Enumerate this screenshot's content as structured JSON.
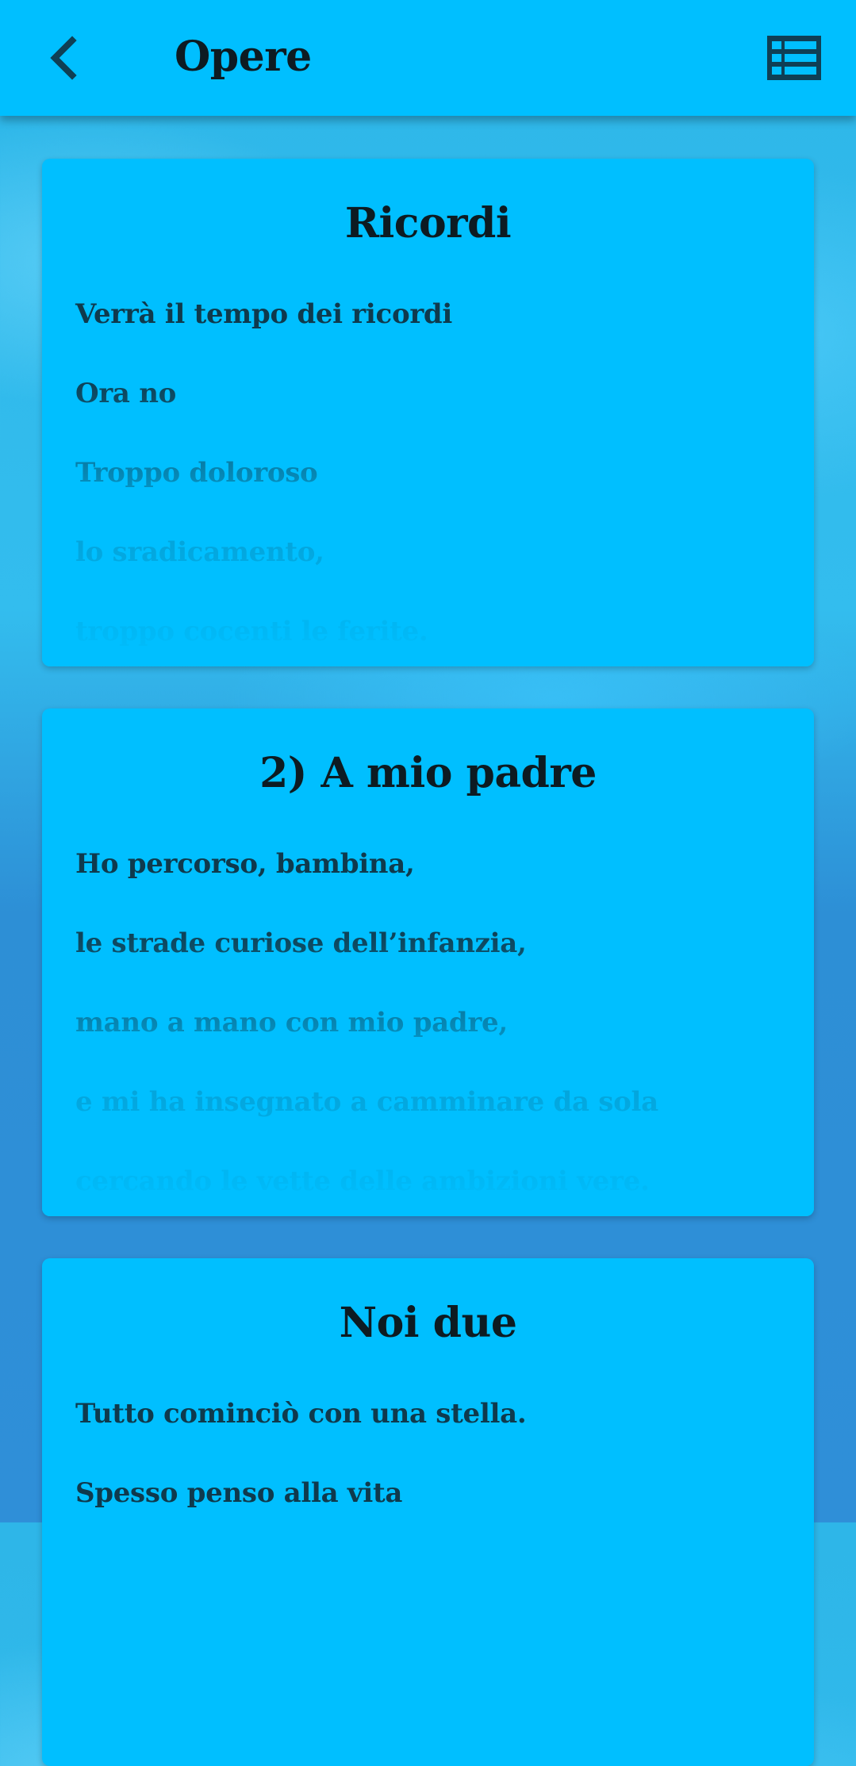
{
  "header": {
    "title": "Opere",
    "back_icon": "chevron-left-icon",
    "menu_icon": "list-view-icon"
  },
  "colors": {
    "accent": "#00bfff",
    "text": "#0d1b22"
  },
  "cards": [
    {
      "title": "Ricordi",
      "lines": [
        "Verrà il tempo dei ricordi",
        "Ora no",
        "Troppo doloroso",
        "lo sradicamento,",
        "troppo cocenti le ferite."
      ]
    },
    {
      "title": "2) A mio padre",
      "lines": [
        "Ho percorso, bambina,",
        "le strade curiose dell’infanzia,",
        "mano a mano con mio padre,",
        "e mi ha insegnato a camminare da sola",
        "cercando le vette delle ambizioni vere."
      ]
    },
    {
      "title": "Noi due",
      "lines": [
        "Tutto cominciò con una stella.",
        "Spesso penso alla vita"
      ]
    }
  ]
}
